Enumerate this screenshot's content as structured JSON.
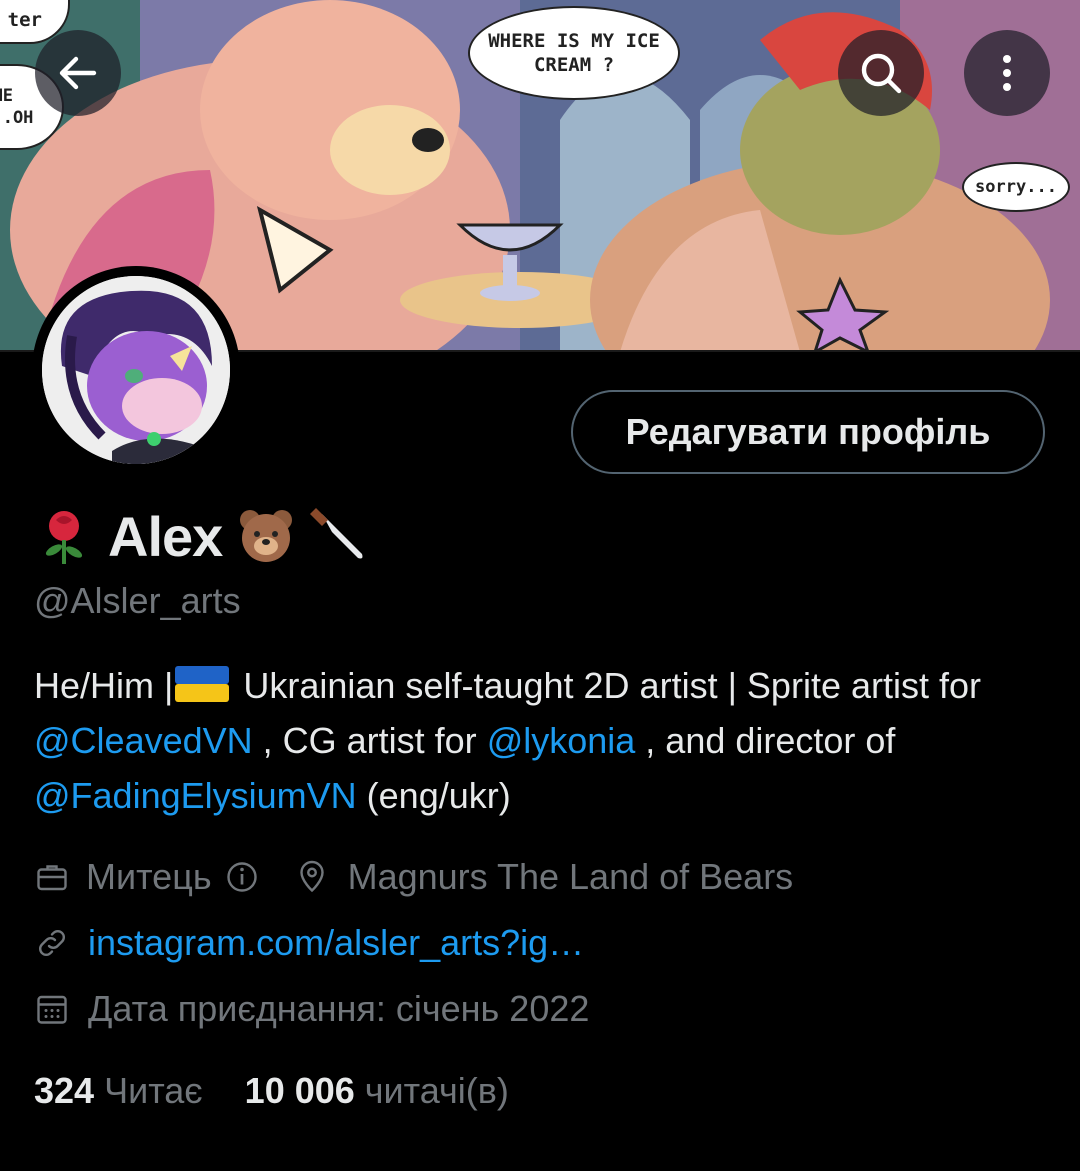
{
  "header": {
    "back_icon": "arrow-left-icon",
    "search_icon": "search-icon",
    "more_icon": "more-vertical-icon"
  },
  "banner": {
    "bubble_where": "WHERE IS MY ICE CREAM ?",
    "bubble_sorry": "sorry...",
    "bubble_left_top": "ter",
    "bubble_left_mid": "COME A...OH"
  },
  "profile": {
    "edit_button": "Редагувати профіль",
    "name": "Alex",
    "handle": "@Alsler_arts",
    "bio": {
      "part1": "He/Him |",
      "part2": " Ukrainian self-taught 2D artist | Sprite artist for ",
      "mention1": "@CleavedVN",
      "part3": " , CG artist for ",
      "mention2": "@lykonia",
      "part4": " , and director of ",
      "mention3": "@FadingElysiumVN",
      "part5": " (eng/ukr)"
    },
    "category": "Митець",
    "location": "Magnurs The Land of Bears",
    "link": "instagram.com/alsler_arts?ig…",
    "joined": "Дата приєднання: січень 2022",
    "following_count": "324",
    "following_label": "Читає",
    "followers_count": "10 006",
    "followers_label": "читачі(в)"
  },
  "colors": {
    "background": "#000000",
    "text": "#e7e9ea",
    "muted": "#71767b",
    "link": "#1d9bf0"
  }
}
